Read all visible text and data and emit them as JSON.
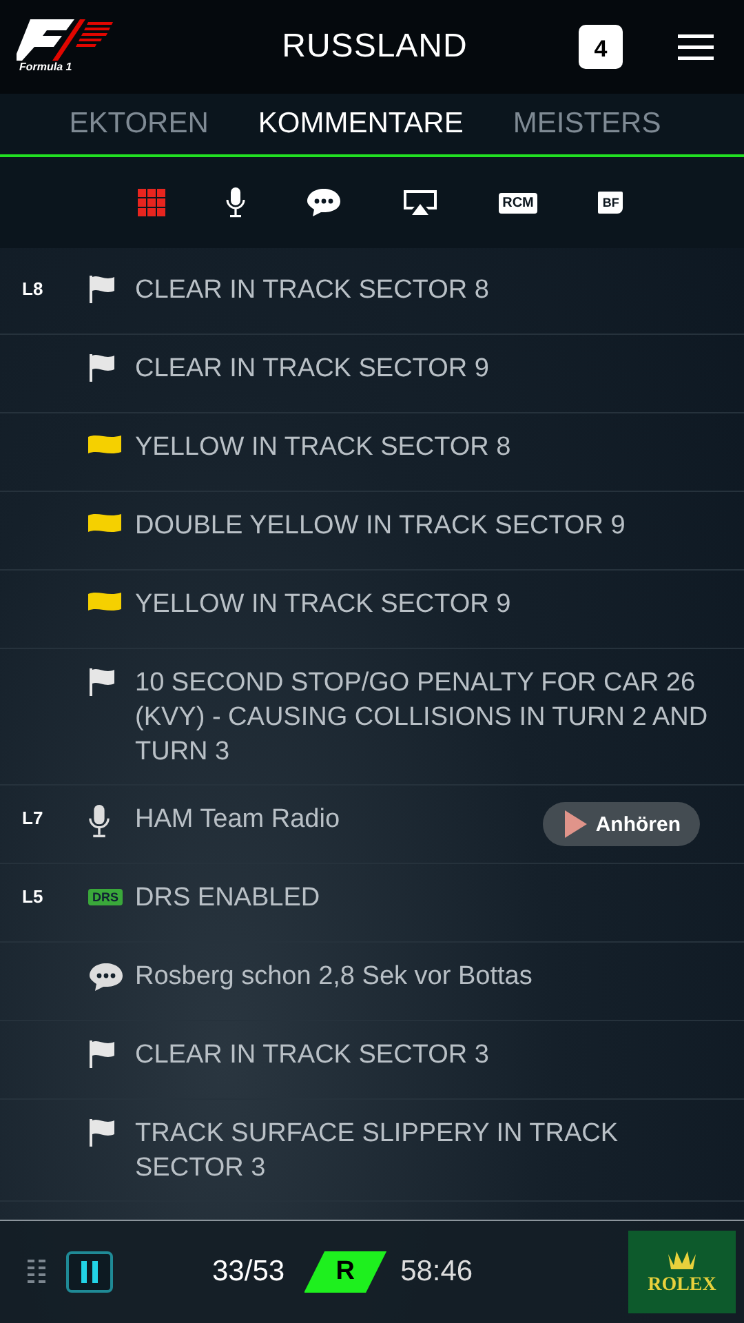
{
  "header": {
    "logo_text": "Formula 1",
    "title": "RUSSLAND",
    "calendar_day": "4"
  },
  "tabs": [
    {
      "label": "EKTOREN",
      "selected": false
    },
    {
      "label": "KOMMENTARE",
      "selected": true
    },
    {
      "label": "MEISTERS",
      "selected": false
    }
  ],
  "filters": [
    {
      "kind": "grid",
      "selected": true
    },
    {
      "kind": "mic",
      "selected": false
    },
    {
      "kind": "chat",
      "selected": false
    },
    {
      "kind": "screen",
      "selected": false
    },
    {
      "kind": "label",
      "label": "RCM",
      "selected": false
    },
    {
      "kind": "flag",
      "label": "BF",
      "selected": false
    }
  ],
  "feed": [
    {
      "lap": "L8",
      "kind": "flag_white",
      "text": "CLEAR IN TRACK SECTOR 8"
    },
    {
      "kind": "flag_white",
      "text": "CLEAR IN TRACK SECTOR 9"
    },
    {
      "kind": "flag_yellow",
      "text": "YELLOW IN TRACK SECTOR 8"
    },
    {
      "kind": "flag_yellow",
      "text": "DOUBLE YELLOW IN TRACK SECTOR 9"
    },
    {
      "kind": "flag_yellow",
      "text": "YELLOW IN TRACK SECTOR 9"
    },
    {
      "kind": "flag_white",
      "text": "10 SECOND STOP/GO PENALTY FOR CAR 26 (KVY) - CAUSING COLLISIONS IN TURN 2 AND TURN 3"
    },
    {
      "lap": "L7",
      "kind": "mic",
      "text": "HAM Team Radio",
      "button": "Anhören"
    },
    {
      "lap": "L5",
      "kind": "drs",
      "badge": "DRS",
      "text": "DRS ENABLED"
    },
    {
      "kind": "chat",
      "text": "Rosberg schon 2,8 Sek vor Bottas"
    },
    {
      "kind": "flag_white",
      "text": "CLEAR IN TRACK SECTOR 3"
    },
    {
      "kind": "flag_white",
      "text": "TRACK SURFACE SLIPPERY IN TRACK SECTOR 3"
    }
  ],
  "footer": {
    "lap": "33/53",
    "session": "R",
    "time": "58:46",
    "sponsor": "ROLEX"
  }
}
